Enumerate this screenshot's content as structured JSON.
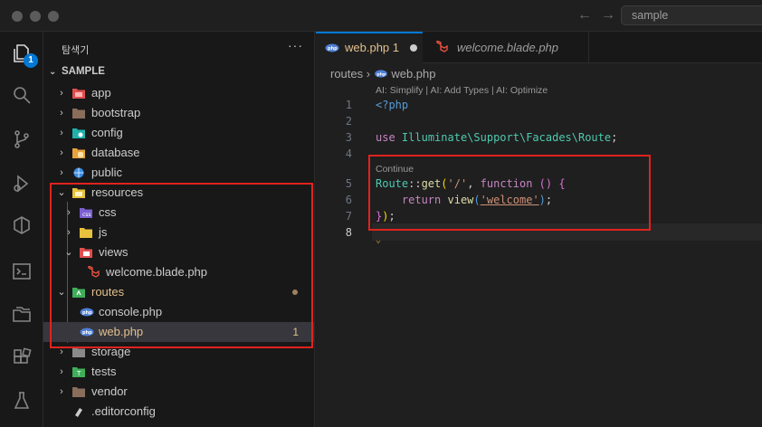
{
  "titlebar": {
    "search_placeholder": "sample"
  },
  "activity": {
    "explorer_badge": "1"
  },
  "sidebar": {
    "title": "탐색기",
    "more": "···",
    "section": "SAMPLE",
    "items": [
      {
        "label": "app",
        "icon": "folder-app-icon",
        "color": "#e04e4e"
      },
      {
        "label": "bootstrap",
        "icon": "folder-icon",
        "color": "#8a6d5b"
      },
      {
        "label": "config",
        "icon": "folder-config-icon",
        "color": "#20b2aa"
      },
      {
        "label": "database",
        "icon": "folder-database-icon",
        "color": "#e8a33d"
      },
      {
        "label": "public",
        "icon": "folder-public-icon",
        "color": "#3a8ee6"
      },
      {
        "label": "resources",
        "icon": "folder-open-icon",
        "color": "#e8c13d"
      },
      {
        "label": "css",
        "icon": "folder-css-icon",
        "color": "#7b5fd0"
      },
      {
        "label": "js",
        "icon": "folder-js-icon",
        "color": "#e8c13d"
      },
      {
        "label": "views",
        "icon": "folder-views-icon",
        "color": "#e04e4e"
      },
      {
        "label": "welcome.blade.php",
        "icon": "laravel-icon",
        "color": "#f05340"
      },
      {
        "label": "routes",
        "icon": "folder-routes-icon",
        "color": "#3fae5a"
      },
      {
        "label": "console.php",
        "icon": "php-icon",
        "color": "#4f7fd6"
      },
      {
        "label": "web.php",
        "icon": "php-icon",
        "color": "#4f7fd6",
        "count": "1"
      },
      {
        "label": "storage",
        "icon": "folder-icon",
        "color": "#8a8a8a"
      },
      {
        "label": "tests",
        "icon": "folder-test-icon",
        "color": "#3fae5a"
      },
      {
        "label": "vendor",
        "icon": "folder-icon",
        "color": "#8a6d5b"
      },
      {
        "label": ".editorconfig",
        "icon": "editorconfig-icon",
        "color": "#cccccc"
      }
    ]
  },
  "tabs": [
    {
      "label": "web.php 1",
      "icon": "php-icon"
    },
    {
      "label": "welcome.blade.php",
      "icon": "laravel-icon"
    }
  ],
  "editor": {
    "breadcrumb": [
      "routes",
      "web.php"
    ],
    "codelens_top": "AI: Simplify | AI: Add Types | AI: Optimize",
    "codelens_continue": "Continue",
    "line_numbers": [
      "1",
      "2",
      "3",
      "4",
      "5",
      "6",
      "7",
      "8"
    ],
    "code": {
      "l1": "<?php",
      "l3_kw": "use",
      "l3_ns": "Illuminate\\Support\\Facades\\Route",
      "l5_cls": "Route",
      "l5_fn": "get",
      "l5_str": "'/'",
      "l5_kw": "function",
      "l6_kw": "return",
      "l6_fn": "view",
      "l6_str": "'welcome'"
    }
  }
}
